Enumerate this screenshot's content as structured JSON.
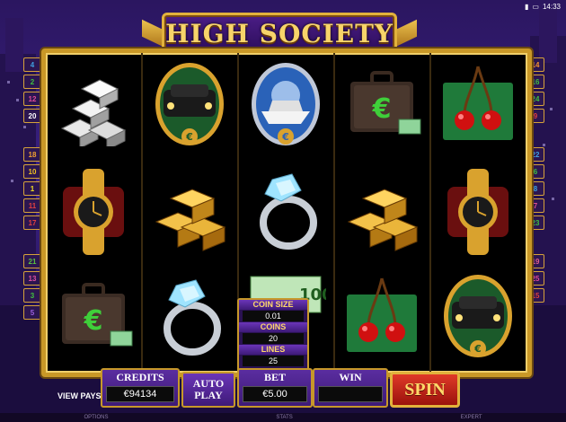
{
  "status": {
    "time": "14:33"
  },
  "logo": {
    "title": "HIGH SOCIETY"
  },
  "paylines": {
    "left": [
      {
        "n": "4",
        "color": "#3fa0e0"
      },
      {
        "n": "2",
        "color": "#3fbf40"
      },
      {
        "n": "12",
        "color": "#e04a9a"
      },
      {
        "n": "20",
        "color": "#ffffff"
      },
      {
        "n": "18",
        "color": "#f0a030"
      },
      {
        "n": "10",
        "color": "#f0c020"
      },
      {
        "n": "1",
        "color": "#f0e020"
      },
      {
        "n": "11",
        "color": "#e04040"
      },
      {
        "n": "17",
        "color": "#e04040"
      },
      {
        "n": "21",
        "color": "#5ac040"
      },
      {
        "n": "13",
        "color": "#e050a0"
      },
      {
        "n": "3",
        "color": "#40c040"
      },
      {
        "n": "5",
        "color": "#9a60e0"
      }
    ],
    "right": [
      {
        "n": "14",
        "color": "#f09030"
      },
      {
        "n": "16",
        "color": "#3fbf40"
      },
      {
        "n": "24",
        "color": "#3fbf40"
      },
      {
        "n": "9",
        "color": "#e04040"
      },
      {
        "n": "22",
        "color": "#3fa0e0"
      },
      {
        "n": "6",
        "color": "#3fbf40"
      },
      {
        "n": "8",
        "color": "#3fa0e0"
      },
      {
        "n": "7",
        "color": "#e05090"
      },
      {
        "n": "23",
        "color": "#3fbf40"
      },
      {
        "n": "19",
        "color": "#e06090"
      },
      {
        "n": "25",
        "color": "#e04a9a"
      },
      {
        "n": "15",
        "color": "#e04040"
      }
    ]
  },
  "reels": [
    [
      "silver-bars",
      "watch",
      "briefcase"
    ],
    [
      "limousine",
      "gold-bars",
      "diamond-ring"
    ],
    [
      "yacht",
      "diamond-ring",
      "money"
    ],
    [
      "briefcase",
      "gold-bars",
      "cherries"
    ],
    [
      "cherries",
      "watch",
      "limousine"
    ]
  ],
  "symbol_text": {
    "euro": "€",
    "money_value": "100"
  },
  "controls": {
    "credits_label": "CREDITS",
    "credits_value": "€94134",
    "auto_play_label_1": "AUTO",
    "auto_play_label_2": "PLAY",
    "bet_label": "BET",
    "bet_value": "€5.00",
    "win_label": "WIN",
    "win_value": "",
    "spin_label": "SPIN",
    "view_pays": "VIEW PAYS"
  },
  "bet_popup": {
    "coin_size_label": "COIN SIZE",
    "coin_size_value": "0.01",
    "coins_label": "COINS",
    "coins_value": "20",
    "lines_label": "LINES",
    "lines_value": "25"
  },
  "bottom_bar": {
    "options": "OPTIONS",
    "stats": "STATS",
    "expert": "EXPERT"
  }
}
